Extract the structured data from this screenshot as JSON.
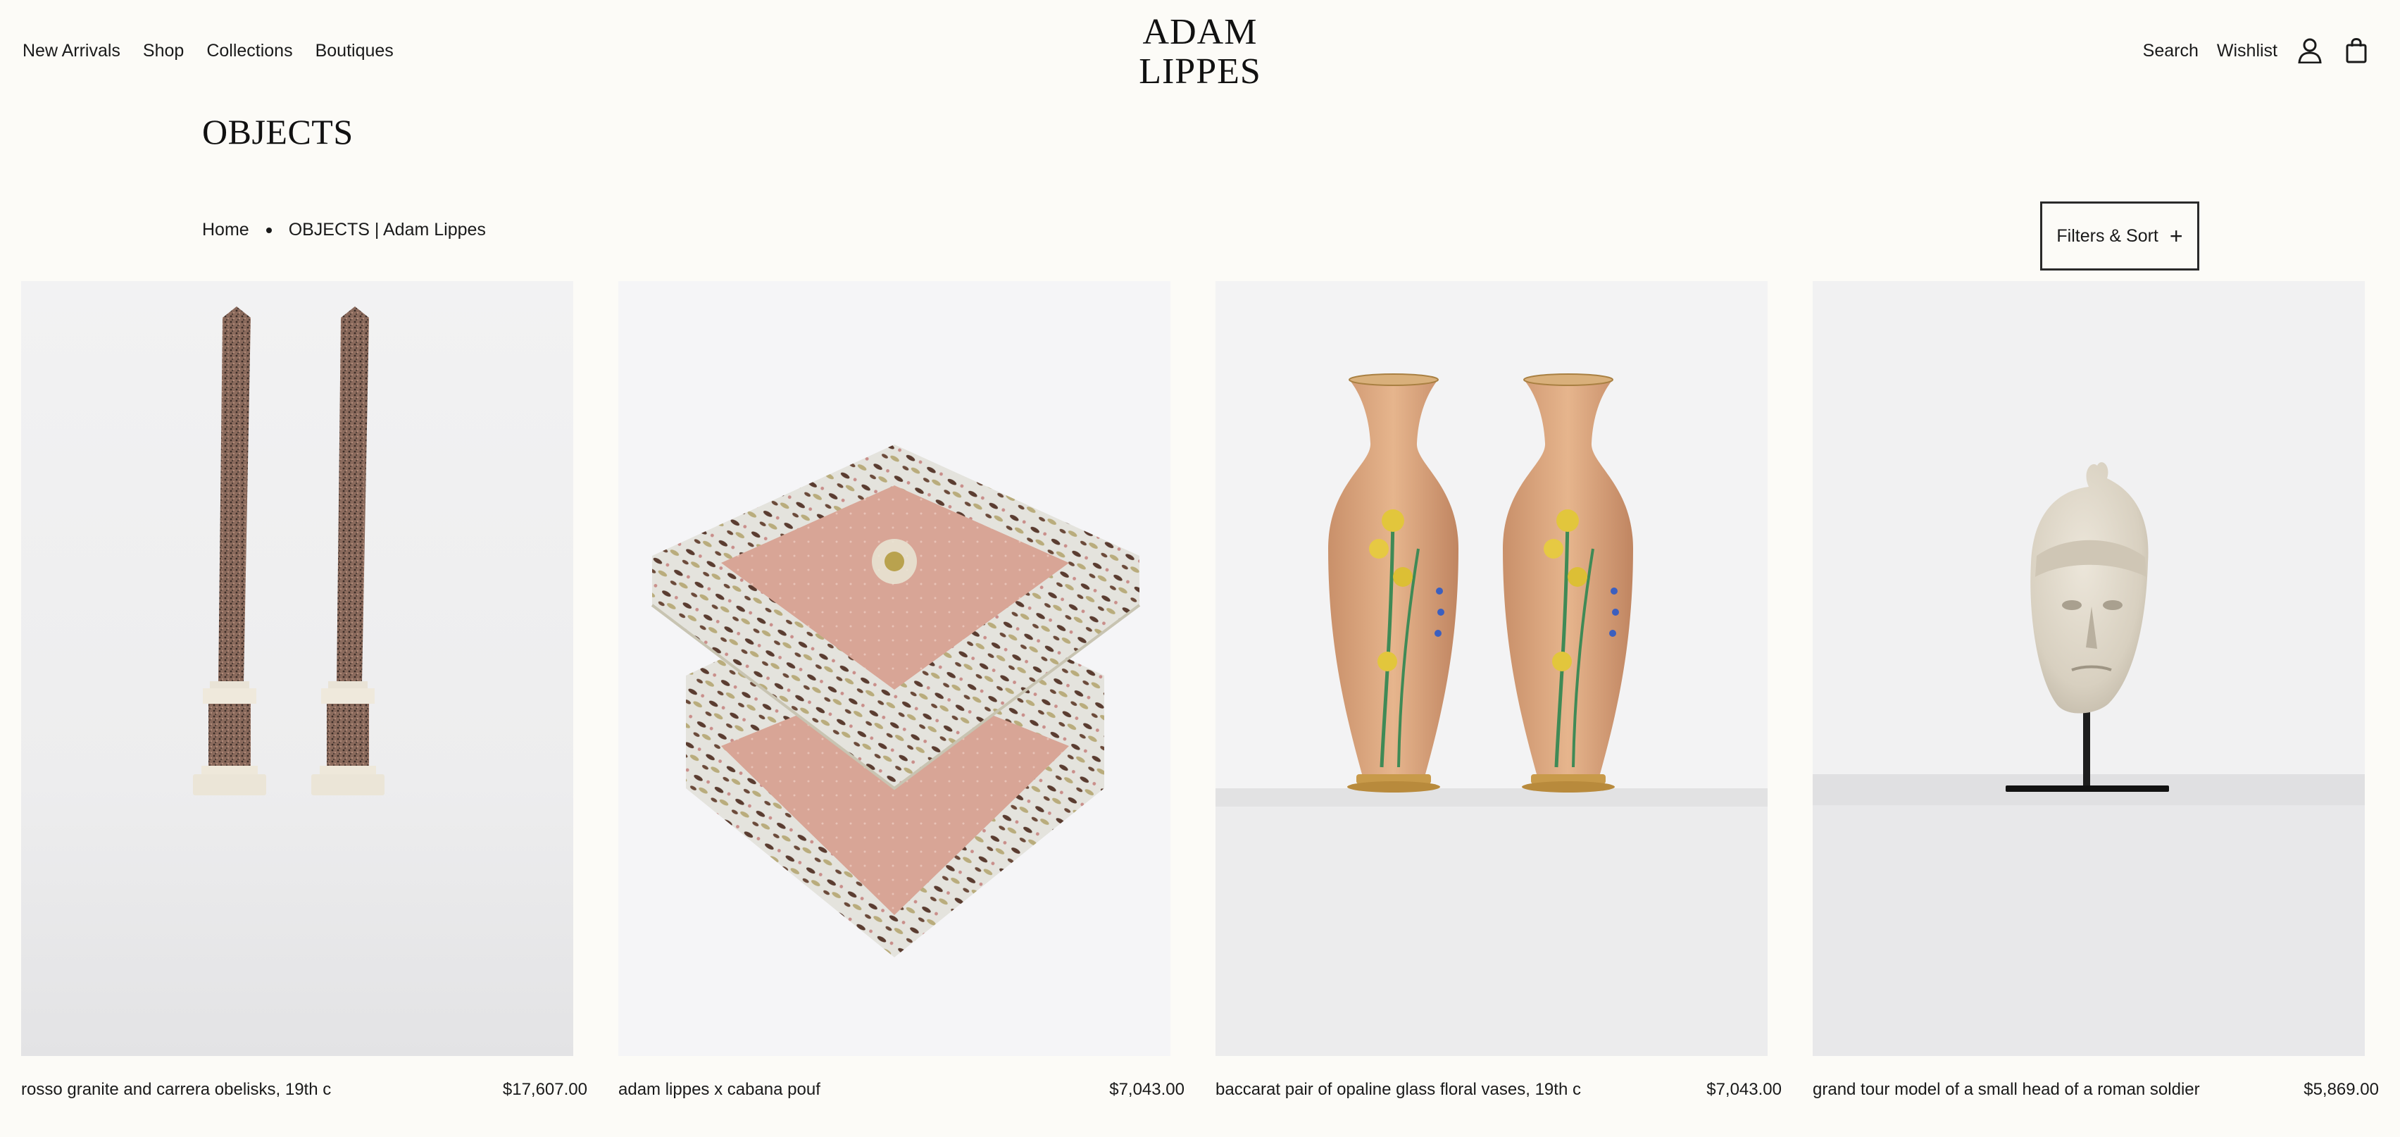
{
  "header": {
    "nav": [
      "New Arrivals",
      "Shop",
      "Collections",
      "Boutiques"
    ],
    "logo_line1": "ADAM",
    "logo_line2": "LIPPES",
    "search_label": "Search",
    "wishlist_label": "Wishlist",
    "account_icon": "user-icon",
    "cart_icon": "bag-icon"
  },
  "page": {
    "title": "OBJECTS",
    "breadcrumb": [
      "Home",
      "OBJECTS | Adam Lippes"
    ],
    "filters_label": "Filters & Sort",
    "filters_icon": "plus-icon"
  },
  "products": [
    {
      "name": "rosso granite and carrera obelisks, 19th c",
      "price": "$17,607.00"
    },
    {
      "name": "adam lippes x cabana pouf",
      "price": "$7,043.00"
    },
    {
      "name": "baccarat pair of opaline glass floral vases, 19th c",
      "price": "$7,043.00"
    },
    {
      "name": "grand tour model of a small head of a roman soldier",
      "price": "$5,869.00"
    }
  ],
  "colors": {
    "background": "#fcfbf7",
    "text": "#1a1a1a"
  }
}
